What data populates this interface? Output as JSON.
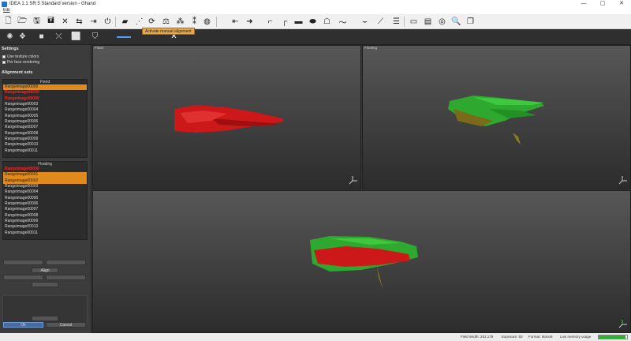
{
  "window": {
    "title": "IDEA 1.1 SR 5 Standard version - Ghand",
    "controls": [
      "—",
      "▢",
      "✕"
    ]
  },
  "menu": {
    "edit": "Edit"
  },
  "toolbar": {
    "tooltip": "Activate manual alignment",
    "row1_icons": [
      "new-file-icon",
      "open-folder-icon",
      "save-icon",
      "save-as-icon",
      "close-icon",
      "swap-icon",
      "export-icon",
      "power-icon",
      "scan-icon",
      "network-icon",
      "refresh-icon",
      "align-icon",
      "points-icon",
      "merge-icon",
      "mesh-icon",
      "arrow-right-icon",
      "hook-icon",
      "corner-icon",
      "rect-icon",
      "ellipse-icon",
      "lasso-icon",
      "curve-icon",
      "curve2-icon",
      "layers-icon",
      "window-icon",
      "view-icon",
      "eye-icon",
      "search-icon",
      "copy-icon"
    ],
    "row2_icons": [
      "sun-icon",
      "cluster-icon",
      "stop-icon",
      "transform-icon",
      "white-square-icon",
      "badge-icon",
      "slider-icon",
      "cross-icon"
    ]
  },
  "settings": {
    "title": "Settings",
    "use_texture": "Use texture colors",
    "per_face": "Per face rendering"
  },
  "alignment": {
    "title": "Alignment sets",
    "fixed_label": "Fixed",
    "fixed_items": [
      {
        "label": "Rangeimage00000",
        "state": "sel"
      },
      {
        "label": "Rangeimage00000",
        "state": "red"
      },
      {
        "label": "Rangeimage00000",
        "state": "red"
      },
      {
        "label": "Rangeimage00003",
        "state": ""
      },
      {
        "label": "Rangeimage00004",
        "state": ""
      },
      {
        "label": "Rangeimage00005",
        "state": ""
      },
      {
        "label": "Rangeimage00006",
        "state": ""
      },
      {
        "label": "Rangeimage00007",
        "state": ""
      },
      {
        "label": "Rangeimage00008",
        "state": ""
      },
      {
        "label": "Rangeimage00009",
        "state": ""
      },
      {
        "label": "Rangeimage00010",
        "state": ""
      },
      {
        "label": "Rangeimage00011",
        "state": ""
      }
    ],
    "floating_label": "Floating",
    "floating_items": [
      {
        "label": "Rangeimage00000",
        "state": "red"
      },
      {
        "label": "Rangeimage00001",
        "state": "sel"
      },
      {
        "label": "Rangeimage00002",
        "state": "sel"
      },
      {
        "label": "Rangeimage00003",
        "state": ""
      },
      {
        "label": "Rangeimage00004",
        "state": ""
      },
      {
        "label": "Rangeimage00005",
        "state": ""
      },
      {
        "label": "Rangeimage00006",
        "state": ""
      },
      {
        "label": "Rangeimage00007",
        "state": ""
      },
      {
        "label": "Rangeimage00008",
        "state": ""
      },
      {
        "label": "Rangeimage00009",
        "state": ""
      },
      {
        "label": "Rangeimage00010",
        "state": ""
      },
      {
        "label": "Rangeimage00011",
        "state": ""
      }
    ],
    "align_label": "Align",
    "ok_label": "Ok",
    "cancel_label": "Cancel"
  },
  "viewports": {
    "fixed": "Fixed",
    "floating": "Floating",
    "merged": ""
  },
  "status": {
    "field_width": "Field Width: 251.178",
    "exposure": "Exposure: 50",
    "format": "Format: Mono8",
    "memory": "Low memory usage",
    "progress": 0.95
  },
  "colors": {
    "accent": "#e08a1c",
    "fixed_mesh": "#d11a1a",
    "floating_mesh": "#2ea82e",
    "selected_red": "#ff2222"
  }
}
